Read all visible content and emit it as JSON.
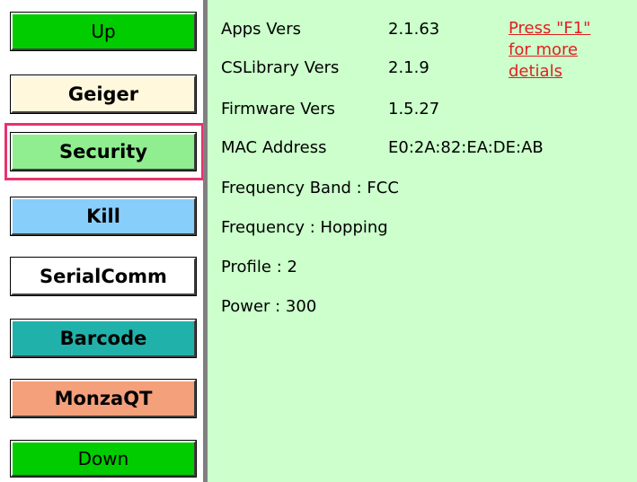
{
  "sidebar": {
    "up": "Up",
    "buttons": [
      {
        "label": "Geiger",
        "color": "#fff8dc"
      },
      {
        "label": "Security",
        "color": "#90ee90"
      },
      {
        "label": "Kill",
        "color": "#87cefa"
      },
      {
        "label": "SerialComm",
        "color": "#ffffff"
      },
      {
        "label": "Barcode",
        "color": "#20b2aa"
      },
      {
        "label": "MonzaQT",
        "color": "#f4a07a"
      }
    ],
    "down": "Down",
    "selected": "Security"
  },
  "info": {
    "apps_label": "Apps Vers",
    "apps_value": "2.1.63",
    "cslib_label": "CSLibrary Vers",
    "cslib_value": "2.1.9",
    "firmware_label": "Firmware Vers",
    "firmware_value": "1.5.27",
    "mac_label": "MAC Address",
    "mac_value": "E0:2A:82:EA:DE:AB",
    "freq_band": "Frequency Band : FCC",
    "frequency": "Frequency : Hopping",
    "profile": "Profile : 2",
    "power": "Power : 300"
  },
  "help": {
    "line1": "Press \"F1\"",
    "line2": "for more",
    "line3": "detials"
  },
  "colors": {
    "panel_bg": "#ccffcc",
    "nav_green": "#00cc00",
    "highlight": "#e8336d",
    "link_red": "#e02020"
  }
}
